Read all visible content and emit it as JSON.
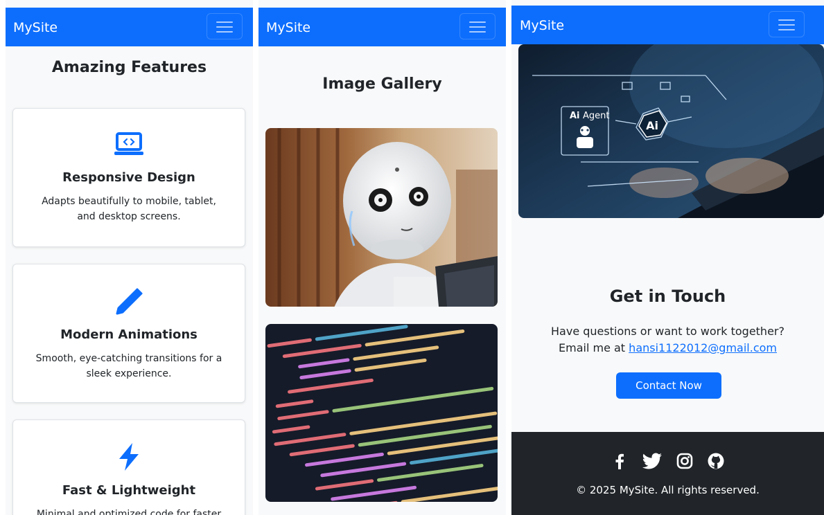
{
  "navbar": {
    "brand": "MySite"
  },
  "features": {
    "title": "Amazing Features",
    "cards": [
      {
        "icon": "laptop-code-icon",
        "title": "Responsive Design",
        "description": "Adapts beautifully to mobile, tablet, and desktop screens."
      },
      {
        "icon": "pen-icon",
        "title": "Modern Animations",
        "description": "Smooth, eye-catching transitions for a sleek experience."
      },
      {
        "icon": "lightning-bolt-icon",
        "title": "Fast & Lightweight",
        "description": "Minimal and optimized code for faster"
      }
    ]
  },
  "gallery": {
    "title": "Image Gallery",
    "images": [
      {
        "icon": "robot-photo"
      },
      {
        "icon": "code-editor-photo"
      }
    ]
  },
  "hero": {
    "icon": "ai-agent-laptop-photo",
    "badge_text": "Agent",
    "chip_text": "Ai"
  },
  "contact": {
    "title": "Get in Touch",
    "line1": "Have questions or want to work together?",
    "line2_prefix": "Email me at",
    "email": "hansi1122012@gmail.com",
    "button": "Contact Now"
  },
  "footer": {
    "social": [
      "facebook-icon",
      "twitter-icon",
      "instagram-icon",
      "github-icon"
    ],
    "copyright": "© 2025 MySite. All rights reserved."
  },
  "colors": {
    "primary": "#0d6efd",
    "footer_bg": "#212529",
    "page_bg": "#f8f9fa"
  }
}
